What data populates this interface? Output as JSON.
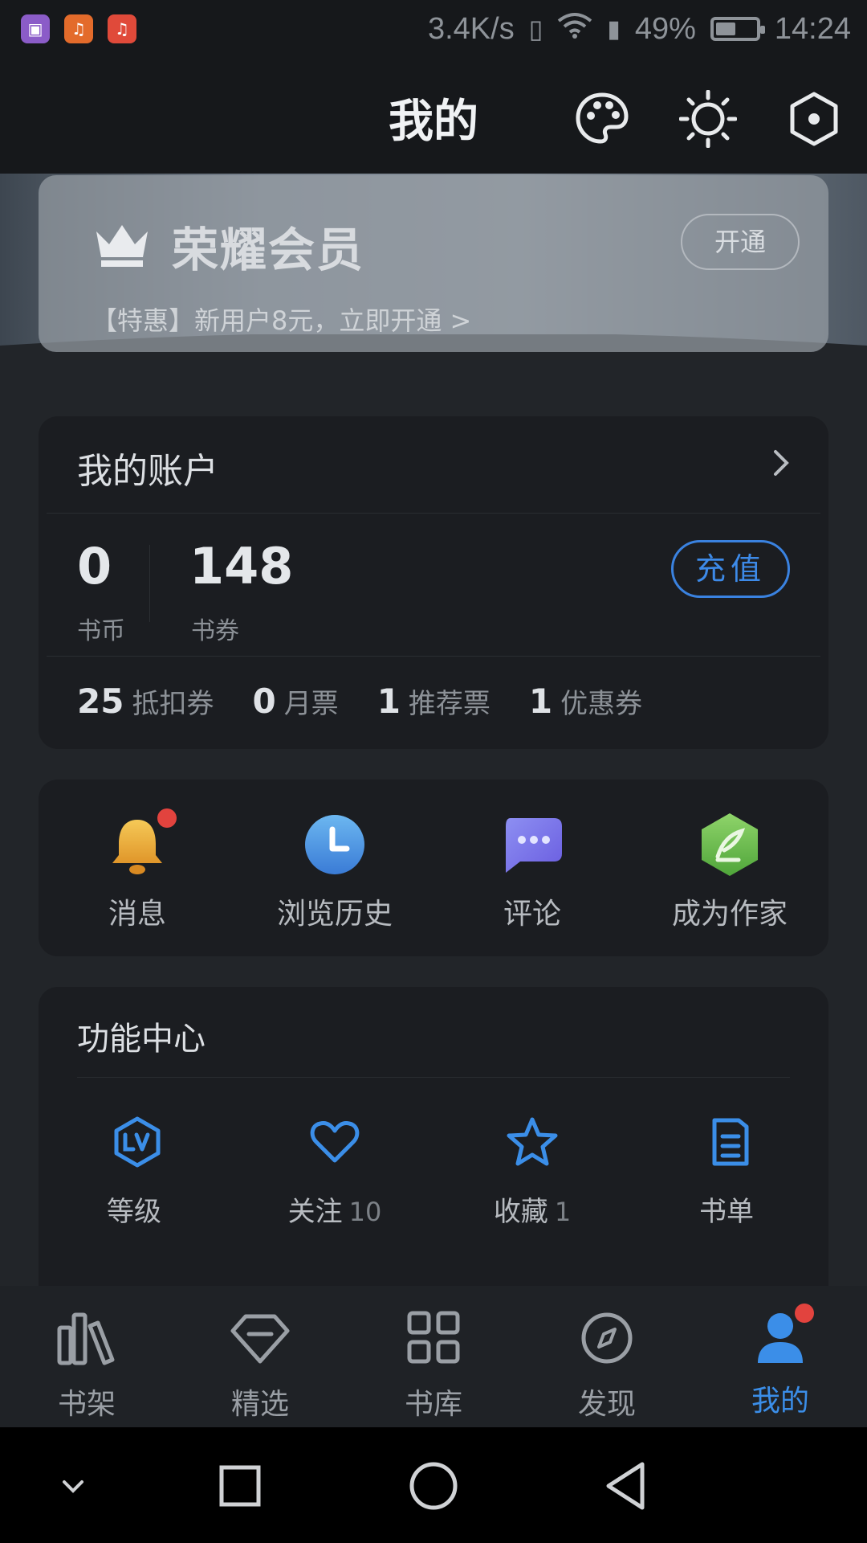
{
  "status_bar": {
    "speed": "3.4K/s",
    "battery": "49%",
    "battery_level": 0.49,
    "time": "14:24"
  },
  "header": {
    "title": "我的"
  },
  "vip": {
    "title": "荣耀会员",
    "button": "开通",
    "promo": "【特惠】新用户8元，立即开通 >"
  },
  "account": {
    "title": "我的账户",
    "coins_value": "0",
    "coins_label": "书币",
    "vouchers_value": "148",
    "vouchers_label": "书券",
    "recharge": "充值",
    "tickets": [
      {
        "count": "25",
        "label": "抵扣券"
      },
      {
        "count": "0",
        "label": "月票"
      },
      {
        "count": "1",
        "label": "推荐票"
      },
      {
        "count": "1",
        "label": "优惠券"
      }
    ]
  },
  "shortcuts": [
    {
      "label": "消息",
      "icon": "bell-icon"
    },
    {
      "label": "浏览历史",
      "icon": "clock-icon"
    },
    {
      "label": "评论",
      "icon": "chat-icon"
    },
    {
      "label": "成为作家",
      "icon": "quill-icon"
    }
  ],
  "features": {
    "title": "功能中心",
    "items": [
      {
        "label": "等级",
        "count": "",
        "icon": "level-icon"
      },
      {
        "label": "关注",
        "count": "10",
        "icon": "heart-icon"
      },
      {
        "label": "收藏",
        "count": "1",
        "icon": "star-icon"
      },
      {
        "label": "书单",
        "count": "",
        "icon": "booklist-icon"
      }
    ]
  },
  "tabs": [
    {
      "label": "书架",
      "icon": "bookshelf-icon"
    },
    {
      "label": "精选",
      "icon": "diamond-icon"
    },
    {
      "label": "书库",
      "icon": "grid-icon"
    },
    {
      "label": "发现",
      "icon": "compass-icon"
    },
    {
      "label": "我的",
      "icon": "user-icon"
    }
  ],
  "colors": {
    "accent": "#3b8ee8",
    "background": "#222529",
    "card": "#1b1d21",
    "badge": "#e2433e"
  }
}
